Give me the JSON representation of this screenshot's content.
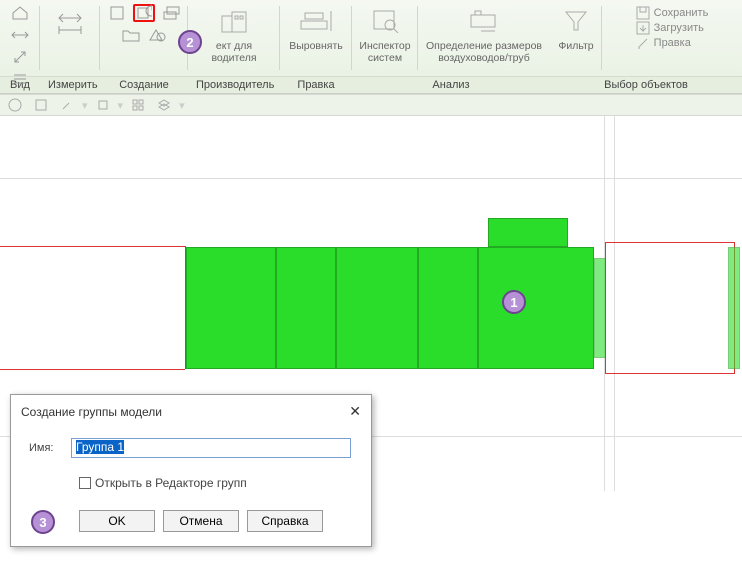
{
  "ribbon": {
    "panels": {
      "view": "Вид",
      "measure": "Измерить",
      "create": "Создание",
      "manufacturer": "Производитель",
      "edit": "Правка",
      "analyze": "Анализ",
      "selection": "Выбор объектов"
    },
    "labels": {
      "manufacturer_content": "ект для\nводителя",
      "align": "Выровнять",
      "inspector": "Инспектор\nсистем",
      "ductsizing": "Определение размеров\nвоздуховодов/труб",
      "filter": "Фильтр"
    },
    "selection_menu": {
      "save": "Сохранить",
      "load": "Загрузить",
      "edit": "Правка"
    }
  },
  "callouts": {
    "c1": "1",
    "c2": "2",
    "c3": "3"
  },
  "dialog": {
    "title": "Создание группы модели",
    "name_label": "Имя:",
    "name_value": "Группа 1",
    "checkbox_label": "Открыть в Редакторе групп",
    "ok": "OK",
    "cancel": "Отмена",
    "help": "Справка"
  }
}
